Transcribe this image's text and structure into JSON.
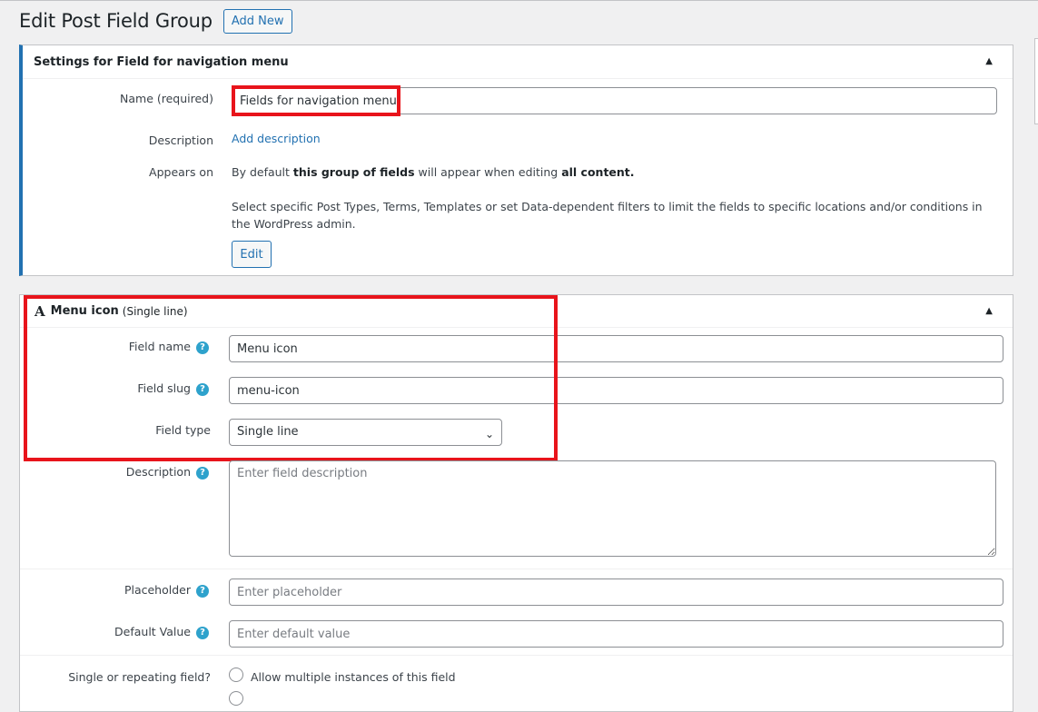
{
  "header": {
    "title": "Edit Post Field Group",
    "add_new_label": "Add New"
  },
  "settings_box": {
    "title": "Settings for Field for navigation menu",
    "name_label": "Name (required)",
    "name_value": "Fields for navigation menu",
    "description_label": "Description",
    "add_description_link": "Add description",
    "appears_on_label": "Appears on",
    "appears_on_text_1": "By default ",
    "appears_on_bold_1": "this group of fields",
    "appears_on_text_2": " will appear when editing ",
    "appears_on_bold_2": "all content.",
    "appears_on_note": "Select specific Post Types, Terms, Templates or set Data-dependent filters to limit the fields to specific locations and/or conditions in the WordPress admin.",
    "edit_label": "Edit"
  },
  "field_box": {
    "type_icon": "A",
    "title": "Menu icon",
    "subtitle": "(Single line)",
    "field_name_label": "Field name",
    "field_name_value": "Menu icon",
    "field_slug_label": "Field slug",
    "field_slug_value": "menu-icon",
    "field_type_label": "Field type",
    "field_type_value": "Single line",
    "description_label": "Description",
    "description_placeholder": "Enter field description",
    "placeholder_label": "Placeholder",
    "placeholder_placeholder": "Enter placeholder",
    "default_value_label": "Default Value",
    "default_value_placeholder": "Enter default value",
    "single_repeating_label": "Single or repeating field?",
    "allow_multiple_label": "Allow multiple instances of this field"
  },
  "icons": {
    "help": "help-icon",
    "collapse": "triangle-up-icon",
    "select": "chevron-down-icon"
  },
  "colors": {
    "accent": "#2271b1",
    "highlight": "#e8141b",
    "help": "#2ea2cc"
  }
}
